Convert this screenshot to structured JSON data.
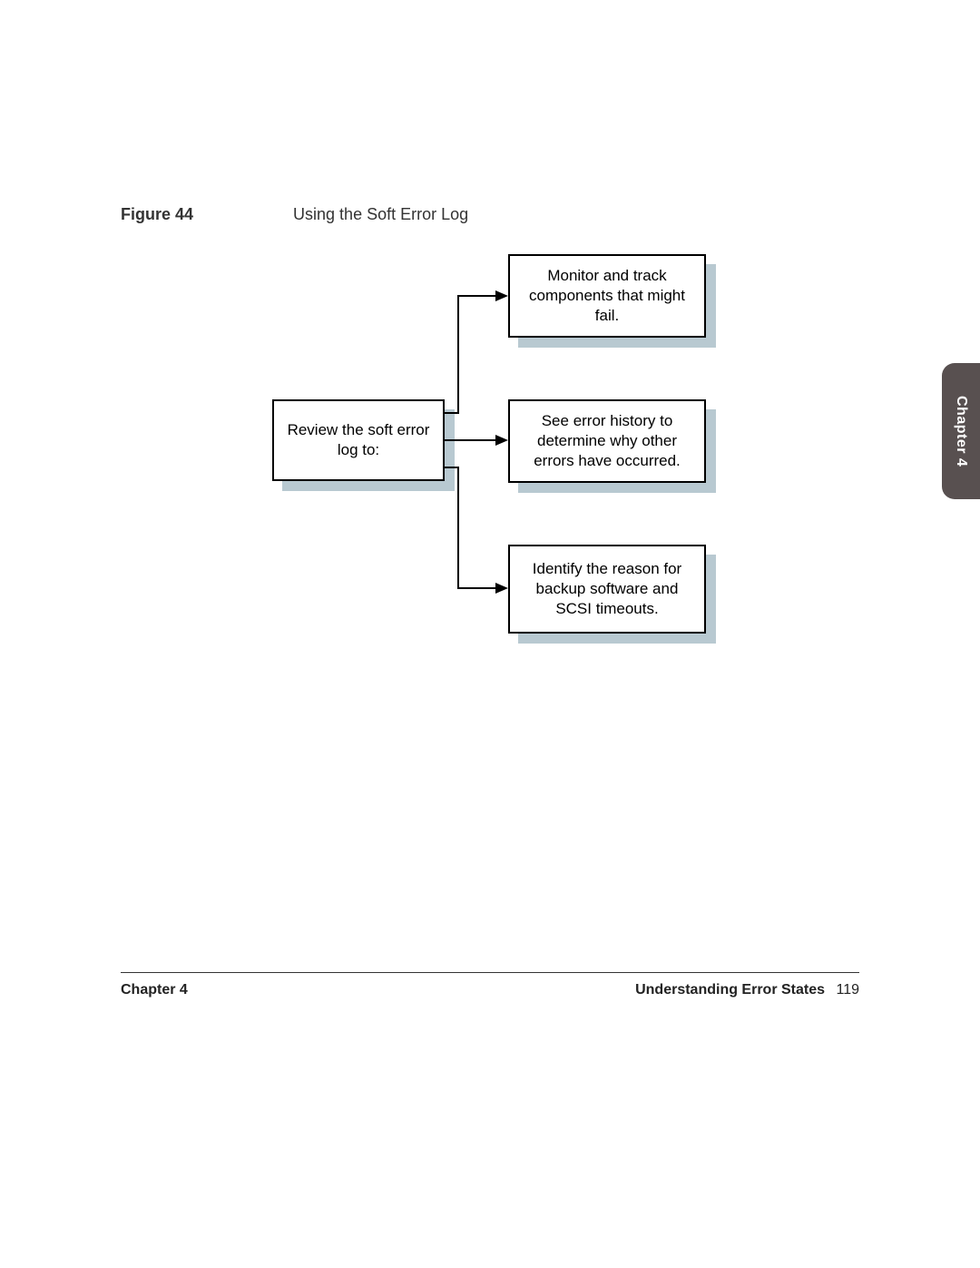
{
  "figure": {
    "label": "Figure 44",
    "caption": "Using the Soft Error Log"
  },
  "diagram": {
    "source": "Review the soft error log to:",
    "targets": [
      "Monitor and track components that might fail.",
      "See error history to determine why other errors have occurred.",
      "Identify the reason for backup software and SCSI timeouts."
    ]
  },
  "side_tab": "Chapter 4",
  "footer": {
    "left": "Chapter 4",
    "right_title": "Understanding Error States",
    "page": "119"
  }
}
